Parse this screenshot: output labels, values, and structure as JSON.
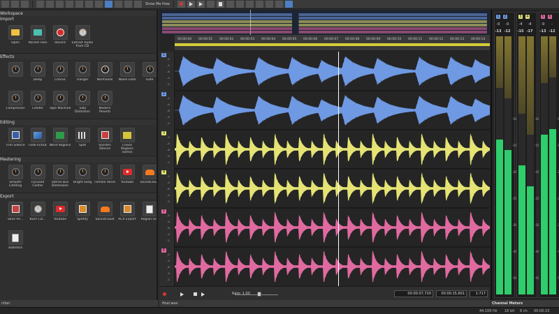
{
  "toolbar": {
    "show_me_how": "Show Me How"
  },
  "left_panel": {
    "sections": [
      {
        "title": "Workspace",
        "subtitle": "Import",
        "tiles": [
          {
            "label": "Open",
            "icon": "folder-icon"
          },
          {
            "label": "Recent Files",
            "icon": "recent-files-icon"
          },
          {
            "label": "Record",
            "icon": "record-icon"
          },
          {
            "label": "Extract Audio from CD",
            "icon": "cd-icon"
          }
        ]
      },
      {
        "title": "Effects",
        "tiles": [
          {
            "label": "",
            "icon": "knob-icon"
          },
          {
            "label": "Delay",
            "icon": "knob-icon"
          },
          {
            "label": "Chorus",
            "icon": "knob-icon"
          },
          {
            "label": "Flanger",
            "icon": "knob-icon"
          },
          {
            "label": "Normalize",
            "icon": "normalize-icon"
          },
          {
            "label": "Noise Gate",
            "icon": "knob-icon"
          },
          {
            "label": "Gate",
            "icon": "knob-icon"
          },
          {
            "label": "Compressor",
            "icon": "knob-icon"
          },
          {
            "label": "Limiter",
            "icon": "knob-icon"
          },
          {
            "label": "Tape Machine",
            "icon": "knob-icon"
          },
          {
            "label": "Tube Distortion",
            "icon": "knob-icon"
          },
          {
            "label": "Modern Reverb",
            "icon": "knob-icon"
          }
        ]
      },
      {
        "title": "Editing",
        "tiles": [
          {
            "label": "Trim Silence",
            "icon": "trim-icon"
          },
          {
            "label": "Fade In/Out",
            "icon": "fade-icon"
          },
          {
            "label": "Word Regions",
            "icon": "regions-icon"
          },
          {
            "label": "Split",
            "icon": "split-icon"
          },
          {
            "label": "Shorten Silence",
            "icon": "shorten-icon"
          },
          {
            "label": "Check Regions names",
            "icon": "check-icon"
          }
        ]
      },
      {
        "title": "Mastering",
        "tiles": [
          {
            "label": "Smooth Limiting",
            "icon": "knob-icon"
          },
          {
            "label": "Focused Center",
            "icon": "knob-icon"
          },
          {
            "label": "Stereo Bus Dimension",
            "icon": "knob-icon"
          },
          {
            "label": "Bright Song",
            "icon": "knob-icon"
          },
          {
            "label": "Female Vocal",
            "icon": "knob-icon"
          },
          {
            "label": "Youtube",
            "icon": "youtube-icon"
          },
          {
            "label": "SoundCloud",
            "icon": "soundcloud-icon"
          }
        ]
      },
      {
        "title": "Export",
        "tiles": [
          {
            "label": "Save As...",
            "icon": "save-icon"
          },
          {
            "label": "Burn CD...",
            "icon": "burn-cd-icon"
          },
          {
            "label": "Youtube",
            "icon": "youtube-icon"
          },
          {
            "label": "Spotify",
            "icon": "spotify-icon"
          },
          {
            "label": "SoundCloud",
            "icon": "soundcloud-icon"
          },
          {
            "label": "ACX Export",
            "icon": "acx-icon"
          },
          {
            "label": "Region List",
            "icon": "region-list-icon"
          },
          {
            "label": "Statistics",
            "icon": "statistics-icon"
          }
        ]
      }
    ],
    "footer": "ction"
  },
  "editor": {
    "ruler_ticks": [
      "00:00:00",
      "00:00:01",
      "00:00:02",
      "00:00:03",
      "00:00:04",
      "00:00:05",
      "00:00:06",
      "00:00:07",
      "00:00:08",
      "00:00:09",
      "00:00:10",
      "00:00:11",
      "00:00:12",
      "00:00:13",
      "00:00:14"
    ],
    "tracks": [
      {
        "num": "1",
        "color": "#6f99e3"
      },
      {
        "num": "2",
        "color": "#6f99e3"
      },
      {
        "num": "3",
        "color": "#e4e374"
      },
      {
        "num": "4",
        "color": "#e4e374"
      },
      {
        "num": "5",
        "color": "#e06aa0"
      },
      {
        "num": "6",
        "color": "#e06aa0"
      }
    ],
    "db_labels": [
      "-2",
      "-4",
      "-8",
      "-4",
      "-2"
    ],
    "transport": {
      "rate_label": "Rate: 1,00",
      "cursor_time": "00:00:07,720",
      "end_time": "00:00:15,601",
      "zoom": "1:717"
    },
    "footer_tab": "final.wav"
  },
  "meters": {
    "title": "Channel Meters",
    "groups": [
      {
        "channels": [
          "1",
          "2"
        ],
        "peaks": [
          "-0",
          "-0"
        ],
        "levels": [
          "-13",
          "-12"
        ],
        "fill": [
          0.6,
          0.56
        ]
      },
      {
        "channels": [
          "3",
          "4"
        ],
        "peaks": [
          "-4",
          "-4"
        ],
        "levels": [
          "-15",
          "-17"
        ],
        "fill": [
          0.5,
          0.42
        ]
      },
      {
        "channels": [
          "5",
          "6"
        ],
        "peaks": [
          "-0",
          "-"
        ],
        "levels": [
          "-13",
          "-12"
        ],
        "fill": [
          0.62,
          0.64
        ]
      }
    ],
    "scale": [
      "-10",
      "-15",
      "-20",
      "-25",
      "-30",
      "-40",
      "-50"
    ],
    "colors": {
      "signal": "#2fcd6c",
      "warn": "#c9b23a"
    }
  },
  "status": {
    "sample_rate": "44.100 Hz",
    "bit_depth": "16 bit",
    "channels": "6 ch.",
    "elapsed": "00:00:15",
    "free": "0:00"
  }
}
